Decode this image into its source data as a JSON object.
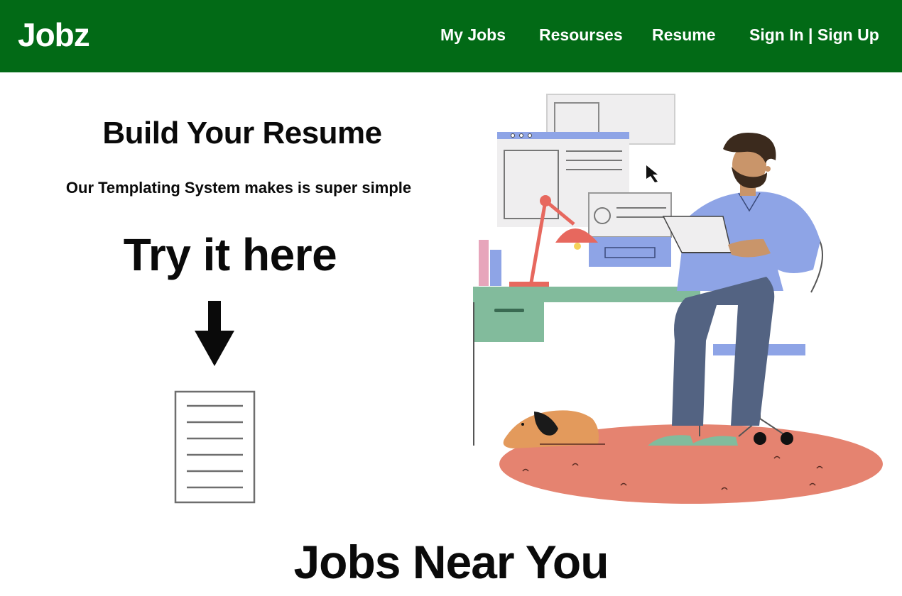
{
  "header": {
    "logo": "Jobz",
    "nav": [
      {
        "label": "My Jobs"
      },
      {
        "label": "Resourses"
      },
      {
        "label": "Resume"
      },
      {
        "label": "Sign In | Sign Up"
      }
    ]
  },
  "hero": {
    "title": "Build Your Resume",
    "subtitle": "Our Templating System makes is super simple",
    "cta": "Try it here",
    "arrow_icon": "arrow-down-icon",
    "document_icon": "document-icon",
    "illustration": "person-working-at-desk-illustration"
  },
  "jobs": {
    "heading": "Jobs Near You"
  },
  "colors": {
    "navbar": "#026a16",
    "nav_text": "#ffffff",
    "text": "#0a0a0a"
  }
}
